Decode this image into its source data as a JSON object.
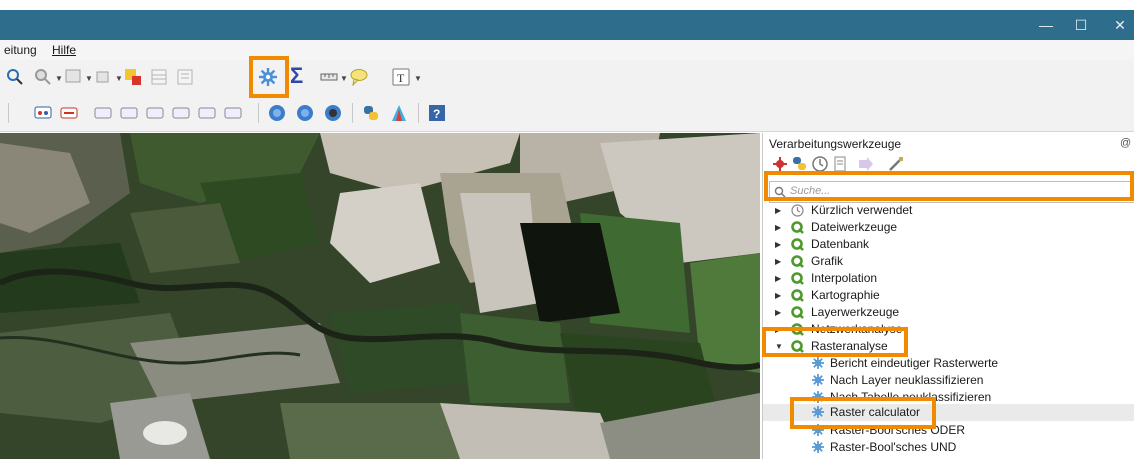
{
  "window": {
    "minimize": "—",
    "maximize": "☐",
    "close": "✕"
  },
  "menubar": {
    "items": [
      "eitung",
      "Hilfe"
    ]
  },
  "toolbar": {
    "row1_icons": [
      "identify-icon",
      "zoom-icon",
      "select-icon",
      "measure-icon",
      "deselect-icon",
      "attribute-table-icon",
      "field-calculator-icon",
      "processing-toolbox-icon",
      "statistics-icon",
      "ruler-icon",
      "annotation-icon",
      "text-annotation-icon"
    ],
    "statistics_symbol": "Σ",
    "row2_icons": [
      "label-icon",
      "label-abc-icon",
      "label-pin-icon",
      "label-show-icon",
      "label-move-icon",
      "label-rotate-icon",
      "label-change-icon",
      "add-wms-icon",
      "add-wcs-icon",
      "add-wfs-icon",
      "python-icon",
      "georef-icon",
      "help-icon"
    ]
  },
  "processing_panel": {
    "title": "Verarbeitungswerkzeuge",
    "float_button": "@",
    "search_placeholder": "Suche...",
    "groups": [
      {
        "label": "Kürzlich verwendet",
        "expanded": false
      },
      {
        "label": "Dateiwerkzeuge",
        "expanded": false
      },
      {
        "label": "Datenbank",
        "expanded": false
      },
      {
        "label": "Grafik",
        "expanded": false
      },
      {
        "label": "Interpolation",
        "expanded": false
      },
      {
        "label": "Kartographie",
        "expanded": false
      },
      {
        "label": "Layerwerkzeuge",
        "expanded": false
      },
      {
        "label": "Netzwerkanalyse",
        "expanded": false
      },
      {
        "label": "Rasteranalyse",
        "expanded": true
      }
    ],
    "raster_algorithms": [
      "Bericht eindeutiger Rasterwerte",
      "Nach Layer neuklassifizieren",
      "Nach Tabelle neuklassifizieren",
      "Raster calculator",
      "Raster-Bool'sches ODER",
      "Raster-Bool'sches UND"
    ]
  },
  "colors": {
    "title_bar": "#2f6d8c",
    "highlight": "#f08a00",
    "qgis_green": "#4d9a2a"
  }
}
